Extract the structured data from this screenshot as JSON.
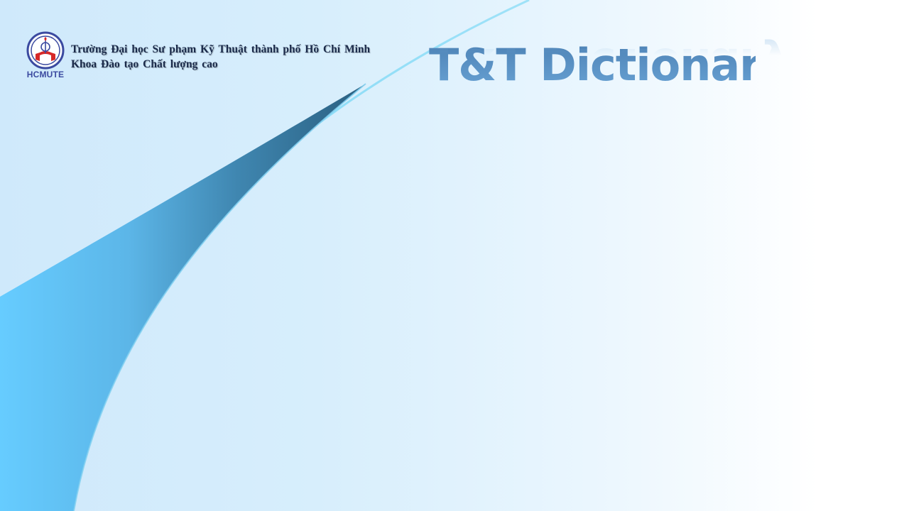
{
  "header": {
    "line1": "Trường Đại học Sư phạm Kỹ Thuật thành phố Hồ Chí Minh",
    "line2": "Khoa Đào tạo Chất lượng cao"
  },
  "logo": {
    "caption": "HCMUTE",
    "icon": "hcmute-logo-icon"
  },
  "title": "T&T Dictionary",
  "colors": {
    "title": "#5b8fc0",
    "header_text": "#1a2a4a",
    "swoosh_light": "#66ccff",
    "swoosh_dark": "#2f6a8c",
    "background_left": "#cfe9fb",
    "background_right": "#ffffff"
  }
}
